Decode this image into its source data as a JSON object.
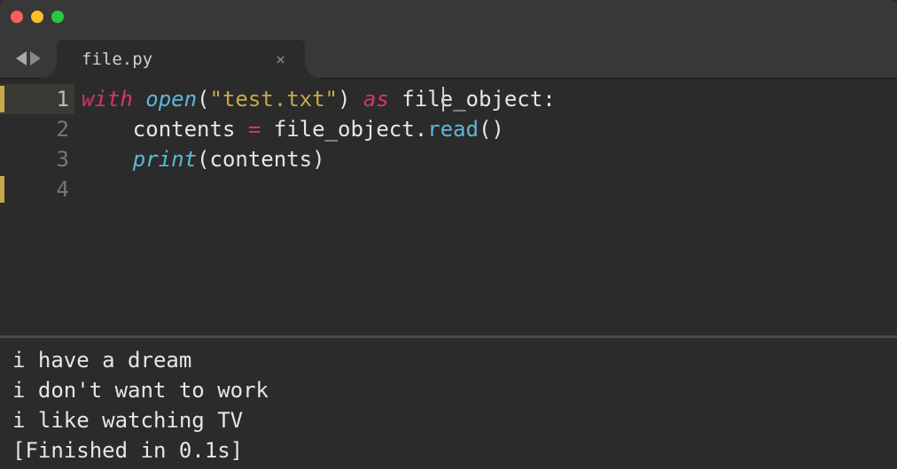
{
  "tab": {
    "filename": "file.py",
    "close_glyph": "×"
  },
  "nav": {
    "back": "◀",
    "forward": "▶"
  },
  "editor": {
    "line_numbers": [
      "1",
      "2",
      "3",
      "4"
    ],
    "active_line": 1,
    "code": {
      "l1": {
        "kw_with": "with",
        "fn_open": "open",
        "paren_open": "(",
        "str": "\"test.txt\"",
        "paren_close": ")",
        "kw_as": "as",
        "ident": "file_object",
        "colon": ":"
      },
      "l2": {
        "indent_ident": "    contents ",
        "eq": "=",
        "sp_ident": " file_object",
        "dot": ".",
        "method": "read",
        "parens": "()"
      },
      "l3": {
        "indent": "    ",
        "fn_print": "print",
        "paren_open": "(",
        "ident": "contents",
        "paren_close": ")"
      }
    }
  },
  "output": {
    "lines": [
      "i have a dream",
      "i don't want to work",
      "i like watching TV",
      "[Finished in 0.1s]"
    ]
  }
}
